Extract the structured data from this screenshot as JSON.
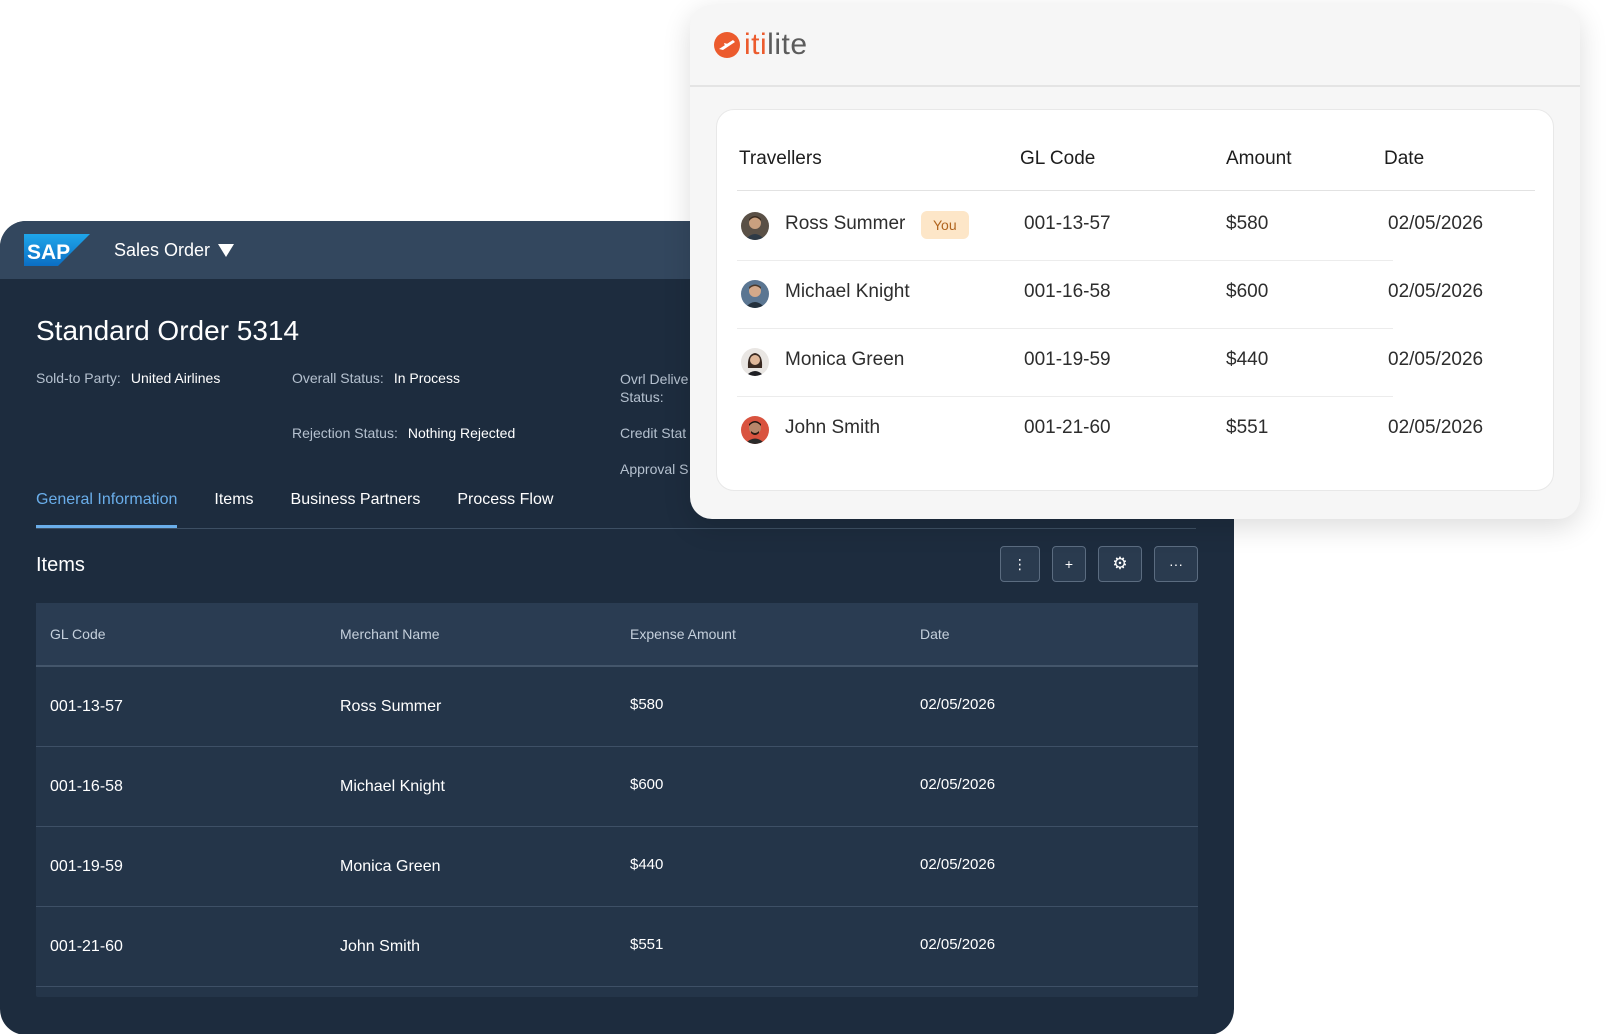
{
  "sap": {
    "logo_text": "SAP",
    "app_title": "Sales Order",
    "order_title": "Standard Order 5314",
    "meta": {
      "sold_to_label": "Sold-to Party:",
      "sold_to_value": "United Airlines",
      "overall_status_label": "Overall Status:",
      "overall_status_value": "In Process",
      "rejection_status_label": "Rejection Status:",
      "rejection_status_value": "Nothing Rejected",
      "ovrl_delivery_label_line1": "Ovrl Delive",
      "ovrl_delivery_label_line2": "Status:",
      "credit_status_label": "Credit Stat",
      "approval_status_label": "Approval S"
    },
    "tabs": [
      {
        "label": "General Information"
      },
      {
        "label": "Items"
      },
      {
        "label": "Business Partners"
      },
      {
        "label": "Process Flow"
      }
    ],
    "items_section_title": "Items",
    "toolbar": {
      "more_vertical": "⋮",
      "add": "+",
      "settings": "⚙",
      "more_horizontal": "···"
    },
    "table": {
      "headers": [
        "GL Code",
        "Merchant Name",
        "Expense Amount",
        "Date"
      ],
      "rows": [
        [
          "001-13-57",
          "Ross Summer",
          "$580",
          "02/05/2026"
        ],
        [
          "001-16-58",
          "Michael Knight",
          "$600",
          "02/05/2026"
        ],
        [
          "001-19-59",
          "Monica Green",
          "$440",
          "02/05/2026"
        ],
        [
          "001-21-60",
          "John Smith",
          "$551",
          "02/05/2026"
        ]
      ]
    }
  },
  "itilite": {
    "brand_first": "iti",
    "brand_rest": "lite",
    "headers": [
      "Travellers",
      "GL Code",
      "Amount",
      "Date"
    ],
    "you_badge": "You",
    "rows": [
      {
        "name": "Ross Summer",
        "gl": "001-13-57",
        "amount": "$580",
        "date": "02/05/2026"
      },
      {
        "name": "Michael Knight",
        "gl": "001-16-58",
        "amount": "$600",
        "date": "02/05/2026"
      },
      {
        "name": "Monica Green",
        "gl": "001-19-59",
        "amount": "$440",
        "date": "02/05/2026"
      },
      {
        "name": "John Smith",
        "gl": "001-21-60",
        "amount": "$551",
        "date": "02/05/2026"
      }
    ]
  },
  "colors": {
    "sap_bg": "#1d2c3e",
    "sap_header": "#33475e",
    "sap_accent": "#6aaeea",
    "itilite_brand": "#ec5b2d",
    "you_badge_bg": "#fde6c8"
  }
}
